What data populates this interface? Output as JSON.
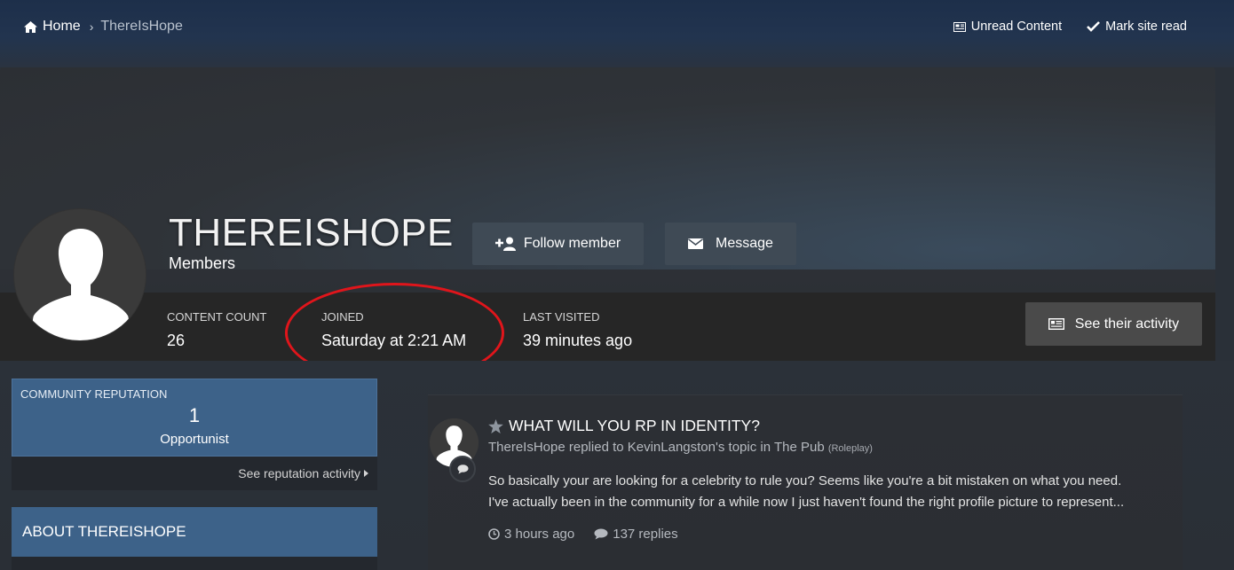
{
  "breadcrumb": {
    "home": "Home",
    "separator": "›",
    "current": "ThereIsHope"
  },
  "topnav": {
    "unread": "Unread Content",
    "mark_read": "Mark site read"
  },
  "profile": {
    "username": "THEREISHOPE",
    "group": "Members",
    "follow_label": "Follow member",
    "message_label": "Message",
    "activity_label": "See their activity"
  },
  "stats": {
    "content_count_label": "CONTENT COUNT",
    "content_count": "26",
    "joined_label": "JOINED",
    "joined": "Saturday at 2:21 AM",
    "last_visited_label": "LAST VISITED",
    "last_visited": "39 minutes ago"
  },
  "reputation": {
    "title": "COMMUNITY REPUTATION",
    "value": "1",
    "rank": "Opportunist",
    "link": "See reputation activity"
  },
  "about": {
    "title": "ABOUT THEREISHOPE"
  },
  "feed": {
    "title": "WHAT WILL YOU RP IN IDENTITY?",
    "meta": "ThereIsHope replied to KevinLangston's topic in The Pub",
    "meta_small": "(Roleplay)",
    "line1": "So basically your are looking for a celebrity to rule you? Seems like you're a bit mistaken on what you need.",
    "line2": "I've actually been in the community for a while now I just haven't found the right profile picture to represent...",
    "time": "3 hours ago",
    "replies": "137 replies"
  },
  "colors": {
    "accent_blue": "#3d6289",
    "highlight_red": "#e0151b"
  },
  "icons": [
    "home-icon",
    "newspaper-icon",
    "check-icon",
    "user-plus-icon",
    "envelope-icon",
    "list-icon",
    "star-icon",
    "clock-icon",
    "comment-icon",
    "caret-right-icon"
  ]
}
